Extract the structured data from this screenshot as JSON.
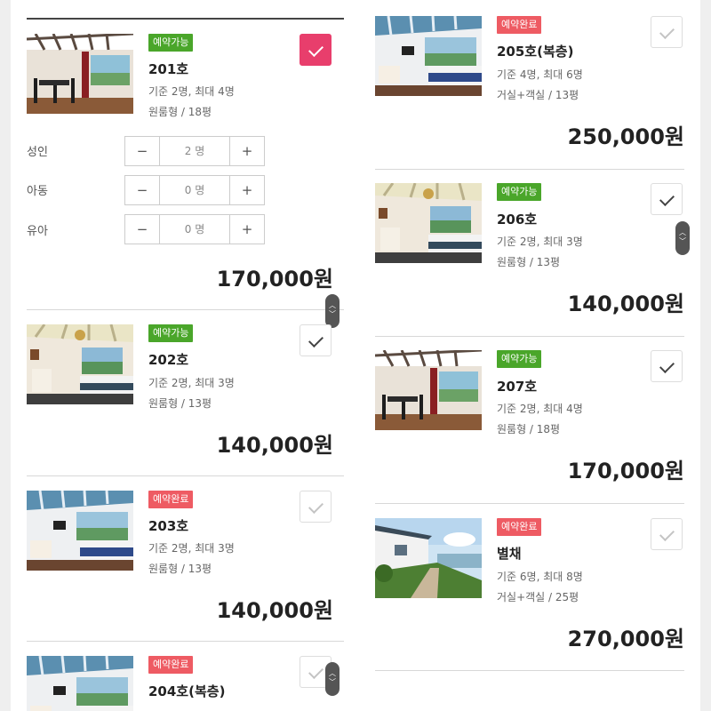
{
  "colors": {
    "available": "#4aa62a",
    "booked": "#ee5b63",
    "checked": "#e83e6c"
  },
  "icons": {
    "check": "check-icon",
    "minus": "minus-icon",
    "plus": "plus-icon",
    "scroll": "scroll-handle-icon"
  },
  "rooms": [
    {
      "name": "201호",
      "status": "예약가능",
      "capacity": "기준 2명, 최대 4명",
      "type": "원룸형 / 18평",
      "price": "170,000원",
      "checked": true
    },
    {
      "name": "202호",
      "status": "예약가능",
      "capacity": "기준 2명, 최대 3명",
      "type": "원룸형 / 13평",
      "price": "140,000원",
      "checked": false
    },
    {
      "name": "203호",
      "status": "예약완료",
      "capacity": "기준 2명, 최대 3명",
      "type": "원룸형 / 13평",
      "price": "140,000원",
      "checked": false
    },
    {
      "name": "204호(복층)",
      "status": "예약완료",
      "capacity": "",
      "type": "",
      "price": "",
      "checked": false
    },
    {
      "name": "205호(복층)",
      "status": "예약완료",
      "capacity": "기준 4명, 최대 6명",
      "type": "거실+객실 / 13평",
      "price": "250,000원",
      "checked": false
    },
    {
      "name": "206호",
      "status": "예약가능",
      "capacity": "기준 2명, 최대 3명",
      "type": "원룸형 / 13평",
      "price": "140,000원",
      "checked": false
    },
    {
      "name": "207호",
      "status": "예약가능",
      "capacity": "기준 2명, 최대 4명",
      "type": "원룸형 / 18평",
      "price": "170,000원",
      "checked": false
    },
    {
      "name": "별채",
      "status": "예약완료",
      "capacity": "기준 6명, 최대 8명",
      "type": "거실+객실 / 25평",
      "price": "270,000원",
      "checked": false
    }
  ],
  "guests": [
    {
      "label": "성인",
      "value": "2 명",
      "minus": "−",
      "plus": "+"
    },
    {
      "label": "아동",
      "value": "0 명",
      "minus": "−",
      "plus": "+"
    },
    {
      "label": "유아",
      "value": "0 명",
      "minus": "−",
      "plus": "+"
    }
  ],
  "scroll_glyphs": {
    "up": "︿",
    "down": "﹀"
  }
}
